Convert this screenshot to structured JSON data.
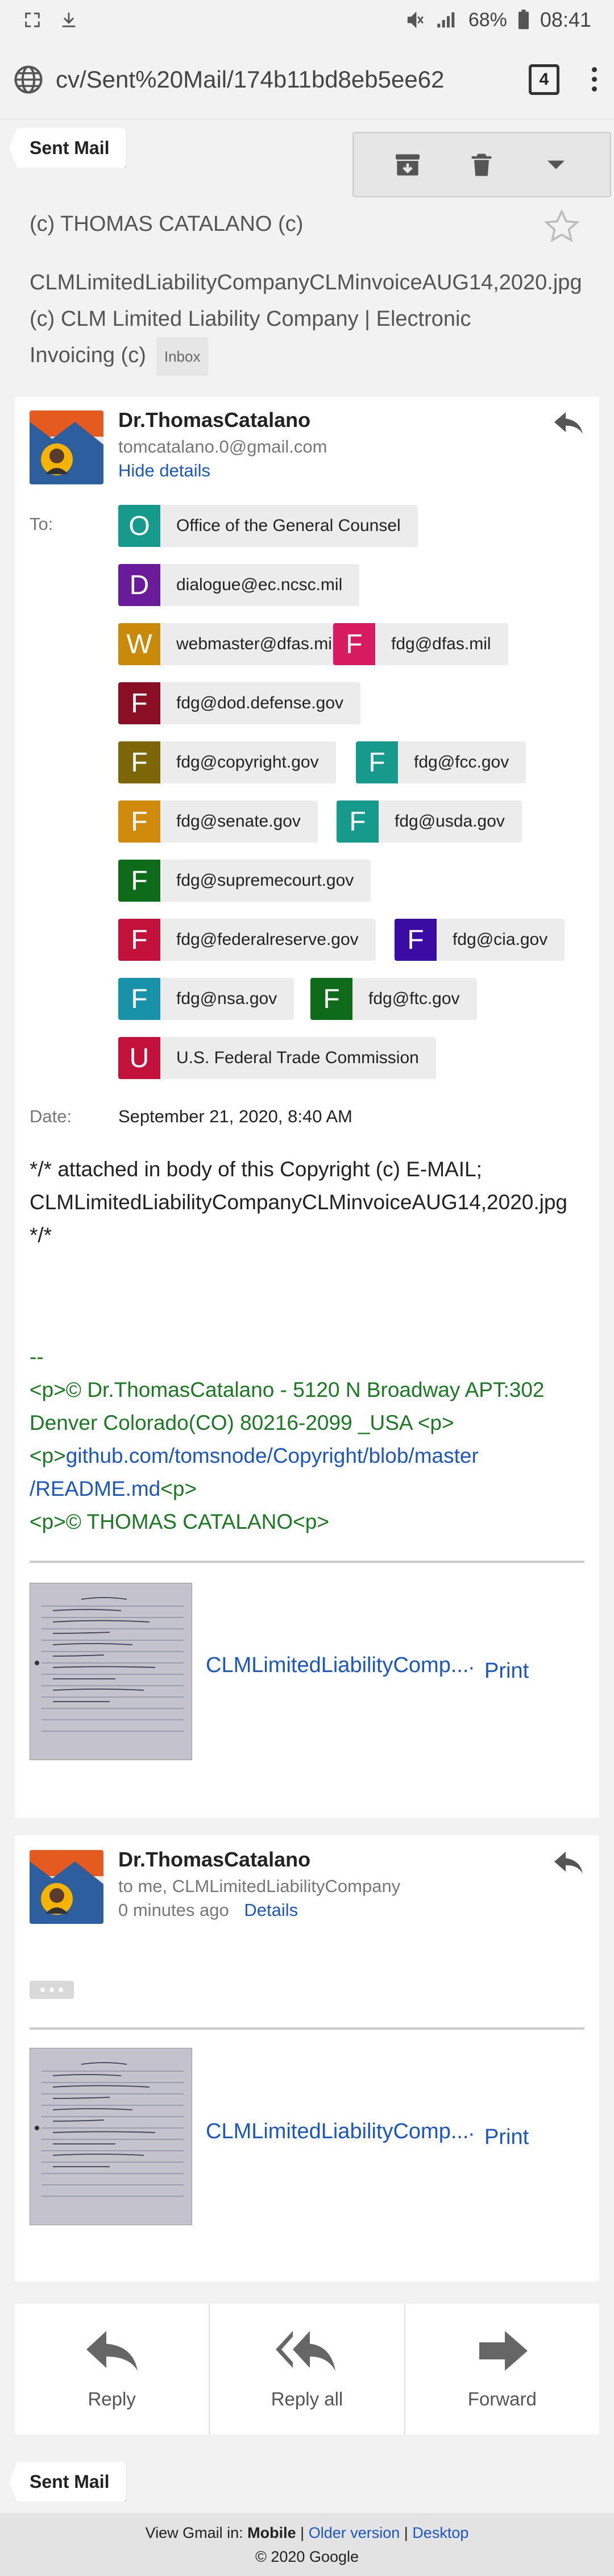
{
  "status_bar": {
    "battery": "68%",
    "time": "08:41"
  },
  "browser": {
    "url": "cv/Sent%20Mail/174b11bd8eb5ee62",
    "tab_count": "4"
  },
  "sent_label": "Sent Mail",
  "subject": {
    "line1": "(c) THOMAS CATALANO (c)",
    "line2": "CLMLimitedLiabilityCompanyCLMinvoiceAUG14,2020.jpg (c) CLM Limited Liability Company | Electronic Invoicing (c)",
    "badge": "Inbox"
  },
  "message1": {
    "sender_name": "Dr.ThomasCatalano",
    "sender_email": "tomcatalano.0@gmail.com",
    "hide_details": "Hide details",
    "to_label": "To:",
    "recipients": [
      {
        "letter": "O",
        "text": "Office of the General Counsel",
        "color": "#159a8c"
      },
      {
        "letter": "D",
        "text": "dialogue@ec.ncsc.mil",
        "color": "#6a1b9a"
      },
      {
        "letter": "W",
        "text": "webmaster@dfas.mil",
        "color": "#c98a0a"
      },
      {
        "letter": "F",
        "text": "fdg@dfas.mil",
        "color": "#d81b60"
      },
      {
        "letter": "F",
        "text": "fdg@dod.defense.gov",
        "color": "#8a0f25"
      },
      {
        "letter": "F",
        "text": "fdg@copyright.gov",
        "color": "#7d6608"
      },
      {
        "letter": "F",
        "text": "fdg@fcc.gov",
        "color": "#159a8c"
      },
      {
        "letter": "F",
        "text": "fdg@senate.gov",
        "color": "#d18b0c"
      },
      {
        "letter": "F",
        "text": "fdg@usda.gov",
        "color": "#159a8c"
      },
      {
        "letter": "F",
        "text": "fdg@supremecourt.gov",
        "color": "#0e6b1a"
      },
      {
        "letter": "F",
        "text": "fdg@federalreserve.gov",
        "color": "#c2123c"
      },
      {
        "letter": "F",
        "text": "fdg@cia.gov",
        "color": "#3a0ca3"
      },
      {
        "letter": "F",
        "text": "fdg@nsa.gov",
        "color": "#1792a8"
      },
      {
        "letter": "F",
        "text": "fdg@ftc.gov",
        "color": "#0e6b1a"
      },
      {
        "letter": "U",
        "text": "U.S. Federal Trade Commission",
        "color": "#c2123c"
      }
    ],
    "date_label": "Date:",
    "date_value": "September 21, 2020, 8:40 AM",
    "body_line1": "*/* attached in body of this Copyright (c) E-MAIL;",
    "body_line2": "CLMLimitedLiabilityCompanyCLMinvoiceAUG14,2020.jpg",
    "body_line3": "*/*",
    "sig_dashes": "--",
    "sig_line1": "<p>© Dr.ThomasCatalano - 5120 N Broadway APT:302",
    "sig_line2": "Denver Colorado(CO) 80216-2099 _USA <p>",
    "sig_line3_prefix": "<p>",
    "sig_link_part1": "github.com/tomsnode/Copyright/blob/master",
    "sig_link_part2": "/README.md",
    "sig_line4_suffix": "<p>",
    "sig_line5": "<p>© THOMAS CATALANO<p>",
    "attachment_name": "CLMLimitedLiabilityComp...",
    "attachment_dot": "·",
    "attachment_print": "Print"
  },
  "message2": {
    "sender_name": "Dr.ThomasCatalano",
    "to_line": "to me, CLMLimitedLiabilityCompany",
    "time": "0 minutes ago",
    "details": "Details",
    "attachment_name": "CLMLimitedLiabilityComp...",
    "attachment_dot": "·",
    "attachment_print": "Print"
  },
  "actions": {
    "reply": "Reply",
    "reply_all": "Reply all",
    "forward": "Forward"
  },
  "footer": {
    "view_prefix": "View Gmail in: ",
    "mobile": "Mobile",
    "sep1": " | ",
    "older": "Older version",
    "sep2": " | ",
    "desktop": "Desktop",
    "copyright": "© 2020 Google"
  }
}
